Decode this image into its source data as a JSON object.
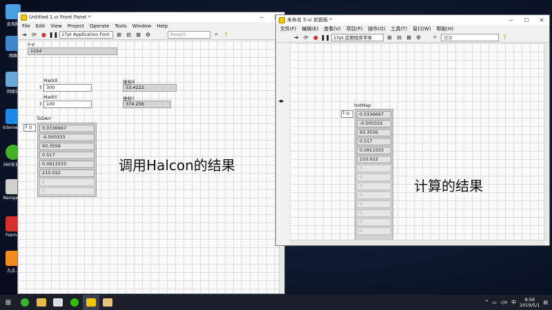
{
  "desktop": {
    "icons": [
      {
        "label": "此电脑"
      },
      {
        "label": "网络"
      },
      {
        "label": "回收站"
      },
      {
        "label": "Internet Explorer"
      },
      {
        "label": "360安全..."
      },
      {
        "label": "Navigat..."
      },
      {
        "label": "Foxm..."
      },
      {
        "label": "九点..."
      }
    ]
  },
  "left_window": {
    "title": "Untitled 1.vi Front Panel *",
    "menu": [
      "File",
      "Edit",
      "View",
      "Project",
      "Operate",
      "Tools",
      "Window",
      "Help"
    ],
    "font_select": "17pt Application Font",
    "search_placeholder": "Search",
    "xy_label": "x-y",
    "xy_value": "1154",
    "markx_label": "MarkX",
    "markx_value": "300",
    "marky_label": "MarkY",
    "marky_value": "100",
    "coordx_label": "坐标X",
    "coordx_value": "53.4222",
    "coordy_label": "坐标Y",
    "coordy_value": "374.256",
    "array_label": "ToDArr",
    "array_index": "0",
    "array_values": [
      "0.0336667",
      "-0.500333",
      "93.3556",
      "0.517",
      "0.0913333",
      "210.022",
      "0",
      "0"
    ],
    "annotation": "调用Halcon的结果"
  },
  "right_window": {
    "title": "未命名 5.vi 前面板 *",
    "menu": [
      "文件(F)",
      "编辑(E)",
      "查看(V)",
      "项目(P)",
      "操作(O)",
      "工具(T)",
      "窗口(W)",
      "帮助(H)"
    ],
    "font_select": "17pt 应用程序字体",
    "search_placeholder": "搜索",
    "array_label": "hotMap",
    "array_index": "0",
    "array_values": [
      "0.0336667",
      "-0.500333",
      "93.3556",
      "0.517",
      "0.0913333",
      "210.022",
      "0",
      "0",
      "0",
      "0",
      "0",
      "0",
      "0",
      "0"
    ],
    "annotation": "计算的结果"
  },
  "taskbar": {
    "lang": "中",
    "time": "8:56",
    "date": "2019/5/1"
  }
}
